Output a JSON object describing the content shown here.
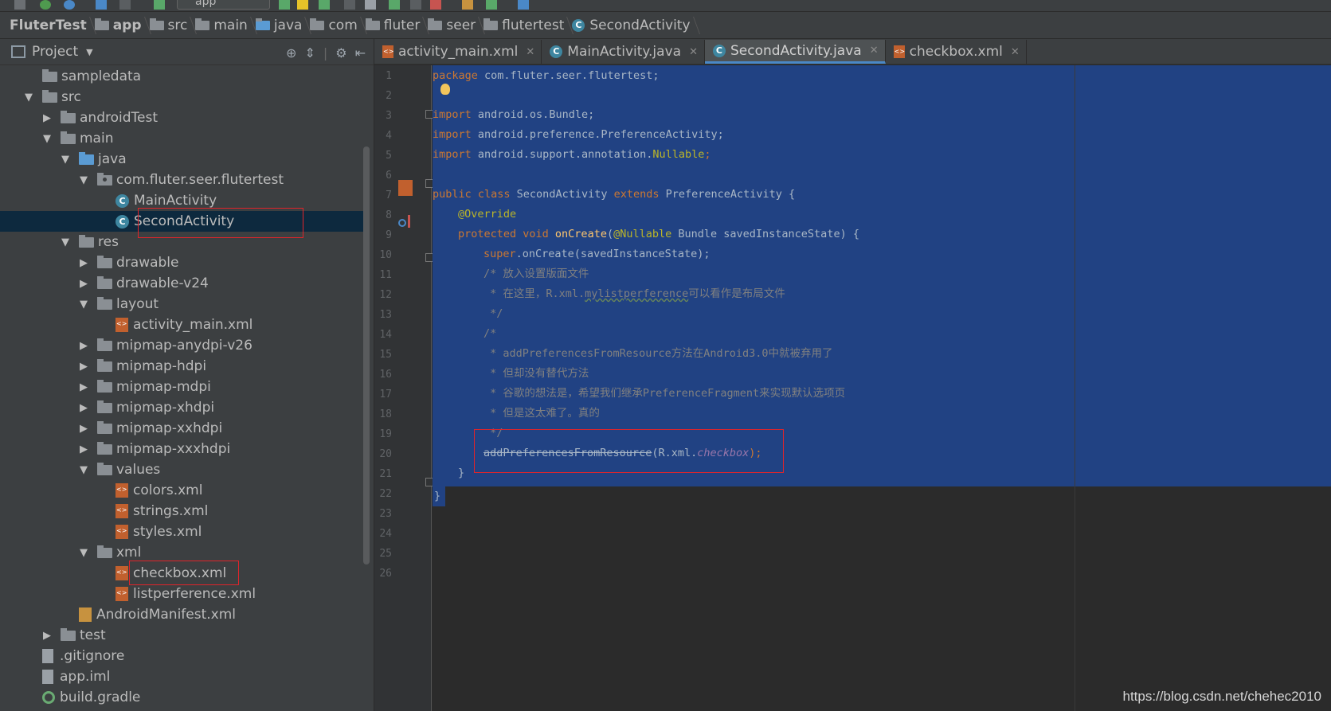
{
  "toolbar": {
    "run_config": "app"
  },
  "breadcrumb": [
    "FluterTest",
    "app",
    "src",
    "main",
    "java",
    "com",
    "fluter",
    "seer",
    "flutertest",
    "SecondActivity"
  ],
  "project_panel": {
    "title": "Project",
    "tree": [
      {
        "label": "sampledata",
        "depth": 2,
        "icon": "folder-icon",
        "expand": "none"
      },
      {
        "label": "src",
        "depth": 2,
        "icon": "folder-icon",
        "expand": "open"
      },
      {
        "label": "androidTest",
        "depth": 3,
        "icon": "folder-icon",
        "expand": "closed"
      },
      {
        "label": "main",
        "depth": 3,
        "icon": "folder-icon",
        "expand": "open"
      },
      {
        "label": "java",
        "depth": 4,
        "icon": "source-folder-icon",
        "expand": "open"
      },
      {
        "label": "com.fluter.seer.flutertest",
        "depth": 5,
        "icon": "package-icon",
        "expand": "open"
      },
      {
        "label": "MainActivity",
        "depth": 6,
        "icon": "class-icon",
        "expand": "none"
      },
      {
        "label": "SecondActivity",
        "depth": 6,
        "icon": "class-icon",
        "expand": "none",
        "selected": true
      },
      {
        "label": "res",
        "depth": 4,
        "icon": "res-folder-icon",
        "expand": "open"
      },
      {
        "label": "drawable",
        "depth": 5,
        "icon": "folder-icon",
        "expand": "closed"
      },
      {
        "label": "drawable-v24",
        "depth": 5,
        "icon": "folder-icon",
        "expand": "closed"
      },
      {
        "label": "layout",
        "depth": 5,
        "icon": "folder-icon",
        "expand": "open"
      },
      {
        "label": "activity_main.xml",
        "depth": 6,
        "icon": "xml-file-icon",
        "expand": "none"
      },
      {
        "label": "mipmap-anydpi-v26",
        "depth": 5,
        "icon": "folder-icon",
        "expand": "closed"
      },
      {
        "label": "mipmap-hdpi",
        "depth": 5,
        "icon": "folder-icon",
        "expand": "closed"
      },
      {
        "label": "mipmap-mdpi",
        "depth": 5,
        "icon": "folder-icon",
        "expand": "closed"
      },
      {
        "label": "mipmap-xhdpi",
        "depth": 5,
        "icon": "folder-icon",
        "expand": "closed"
      },
      {
        "label": "mipmap-xxhdpi",
        "depth": 5,
        "icon": "folder-icon",
        "expand": "closed"
      },
      {
        "label": "mipmap-xxxhdpi",
        "depth": 5,
        "icon": "folder-icon",
        "expand": "closed"
      },
      {
        "label": "values",
        "depth": 5,
        "icon": "folder-icon",
        "expand": "open"
      },
      {
        "label": "colors.xml",
        "depth": 6,
        "icon": "xml-file-icon",
        "expand": "none"
      },
      {
        "label": "strings.xml",
        "depth": 6,
        "icon": "xml-file-icon",
        "expand": "none"
      },
      {
        "label": "styles.xml",
        "depth": 6,
        "icon": "xml-file-icon",
        "expand": "none"
      },
      {
        "label": "xml",
        "depth": 5,
        "icon": "folder-icon",
        "expand": "open"
      },
      {
        "label": "checkbox.xml",
        "depth": 6,
        "icon": "xml-file-icon",
        "expand": "none"
      },
      {
        "label": "listperference.xml",
        "depth": 6,
        "icon": "xml-file-icon",
        "expand": "none"
      },
      {
        "label": "AndroidManifest.xml",
        "depth": 4,
        "icon": "manifest-icon",
        "expand": "none"
      },
      {
        "label": "test",
        "depth": 3,
        "icon": "folder-icon",
        "expand": "closed"
      },
      {
        "label": ".gitignore",
        "depth": 2,
        "icon": "text-file-icon",
        "expand": "none"
      },
      {
        "label": "app.iml",
        "depth": 2,
        "icon": "iml-file-icon",
        "expand": "none"
      },
      {
        "label": "build.gradle",
        "depth": 2,
        "icon": "gradle-icon",
        "expand": "none"
      }
    ]
  },
  "editor": {
    "tabs": [
      {
        "label": "activity_main.xml",
        "icon": "xml-file-icon",
        "active": false
      },
      {
        "label": "MainActivity.java",
        "icon": "class-icon",
        "active": false
      },
      {
        "label": "SecondActivity.java",
        "icon": "class-icon",
        "active": true
      },
      {
        "label": "checkbox.xml",
        "icon": "xml-file-icon",
        "active": false
      }
    ],
    "line_numbers": [
      "1",
      "2",
      "3",
      "4",
      "5",
      "6",
      "7",
      "8",
      "9",
      "10",
      "11",
      "12",
      "13",
      "14",
      "15",
      "16",
      "17",
      "18",
      "19",
      "20",
      "21",
      "22",
      "23",
      "24",
      "25",
      "26"
    ],
    "code": {
      "l1_kw": "package",
      "l1_rest": " com.fluter.seer.flutertest;",
      "l3_kw": "import",
      "l3_rest": " android.os.Bundle;",
      "l4_kw": "import",
      "l4_rest": " android.preference.PreferenceActivity;",
      "l5_kw": "import",
      "l5_rest": " android.support.annotation.",
      "l5_ann": "Nullable",
      "l5_end": ";",
      "l7_kw1": "public class",
      "l7_name": " SecondActivity ",
      "l7_kw2": "extends",
      "l7_rest": " PreferenceActivity {",
      "l8_ann": "@Override",
      "l9_kw": "protected void",
      "l9_fn": " onCreate",
      "l9_p": "(",
      "l9_ann": "@Nullable",
      "l9_rest": " Bundle savedInstanceState) {",
      "l10_kw": "super",
      "l10_rest": ".onCreate(savedInstanceState);",
      "l11": "/* 放入设置版面文件",
      "l12_a": " * 在这里，R.xml.",
      "l12_b": "mylistperference",
      "l12_c": "可以看作是布局文件",
      "l13": " */",
      "l14": "/*",
      "l15": " * addPreferencesFromResource方法在Android3.0中就被弃用了",
      "l16": " * 但却没有替代方法",
      "l17": " * 谷歌的想法是，希望我们继承PreferenceFragment来实现默认选项页",
      "l18": " * 但是这太难了。真的",
      "l19": " */",
      "l20_a": "addPreferencesFromResource",
      "l20_b": "(R.xml.",
      "l20_c": "checkbox",
      "l20_d": ");",
      "l21": "}",
      "l22": "}"
    }
  },
  "watermark": "https://blog.csdn.net/chehec2010"
}
